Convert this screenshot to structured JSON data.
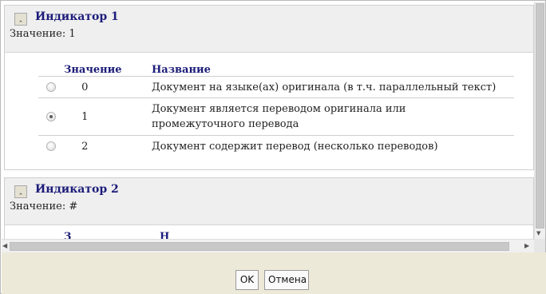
{
  "sections": [
    {
      "title": "Индикатор 1",
      "value_text": "Значение: 1",
      "headers": {
        "value": "Значение",
        "name": "Название"
      },
      "options": [
        {
          "value": "0",
          "name": "Документ на языке(ах) оригинала (в т.ч. параллельный текст)",
          "selected": false
        },
        {
          "value": "1",
          "name": "Документ является переводом оригинала или промежуточного перевода",
          "selected": true
        },
        {
          "value": "2",
          "name": "Документ содержит перевод (несколько переводов)",
          "selected": false
        }
      ]
    },
    {
      "title": "Индикатор 2",
      "value_text": "Значение: #",
      "headers": {
        "value": "З",
        "name": "Н"
      }
    }
  ],
  "footer": {
    "ok_label": "OK",
    "cancel_label": "Отмена"
  },
  "icons": {
    "collapse": "collapse-up-icon"
  },
  "colors": {
    "title": "#1c1c7a",
    "footer_bg": "#ece9d8",
    "header_bg": "#efefef"
  }
}
